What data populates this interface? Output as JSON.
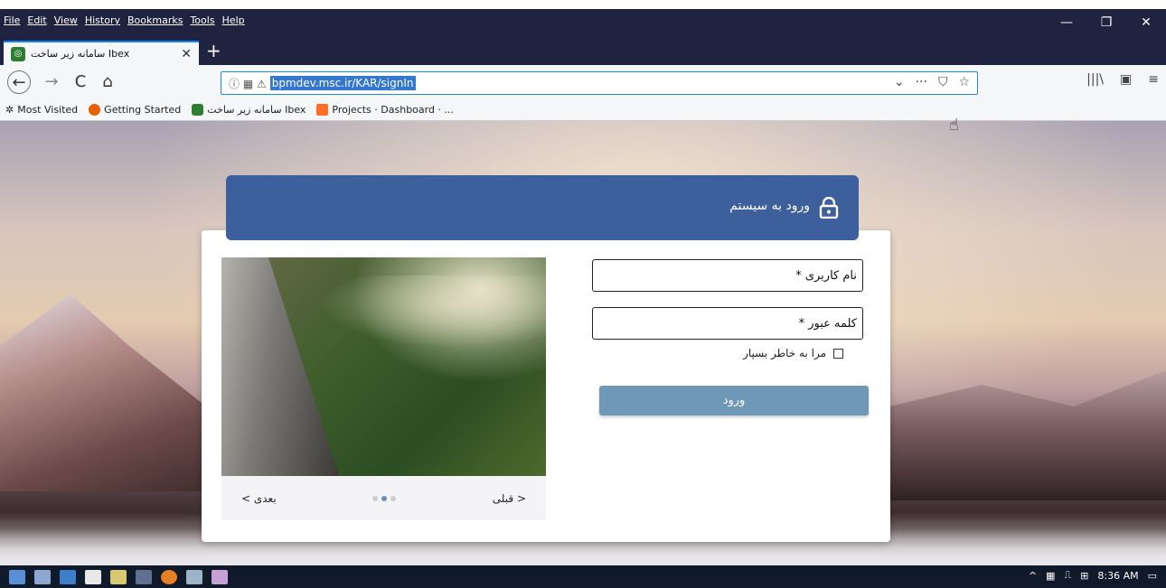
{
  "menubar": {
    "items": [
      "File",
      "Edit",
      "View",
      "History",
      "Bookmarks",
      "Tools",
      "Help"
    ]
  },
  "window_controls": {
    "minimize": "—",
    "restore": "❐",
    "close": "✕"
  },
  "tabs": [
    {
      "label": "سامانه زیر ساخت Ibex",
      "close": "✕"
    }
  ],
  "newtab_label": "+",
  "nav": {
    "back": "←",
    "forward": "→",
    "reload": "C",
    "home": "⌂"
  },
  "url": "bpmdev.msc.ir/KAR/signIn",
  "url_actions": {
    "dropdown": "⌄",
    "more": "···",
    "pocket": "⛉",
    "star": "☆"
  },
  "toolbar_right": {
    "library": "|||\\",
    "sidebar": "▣",
    "menu": "≡"
  },
  "bookmarks": [
    {
      "label": "Most Visited",
      "color": "#555555"
    },
    {
      "label": "Getting Started",
      "color": "#e66000"
    },
    {
      "label": "سامانه زیر ساخت Ibex",
      "color": "#2f7d32"
    },
    {
      "label": "Projects · Dashboard · ...",
      "color": "#fc6d26"
    }
  ],
  "login": {
    "header_title": "ورود به سیستم",
    "username_placeholder": "نام کاربری *",
    "password_placeholder": "کلمه عبور *",
    "remember_label": "مرا به خاطر بسپار",
    "submit_label": "ورود",
    "accent_color": "#3d5f9c",
    "button_color": "#6e98b6"
  },
  "slider": {
    "prev_label": "< قبلی",
    "next_label": "بعدی >",
    "dot_count": 3,
    "active_dot": 1
  },
  "taskbar": {
    "clock": "8:36 AM"
  }
}
